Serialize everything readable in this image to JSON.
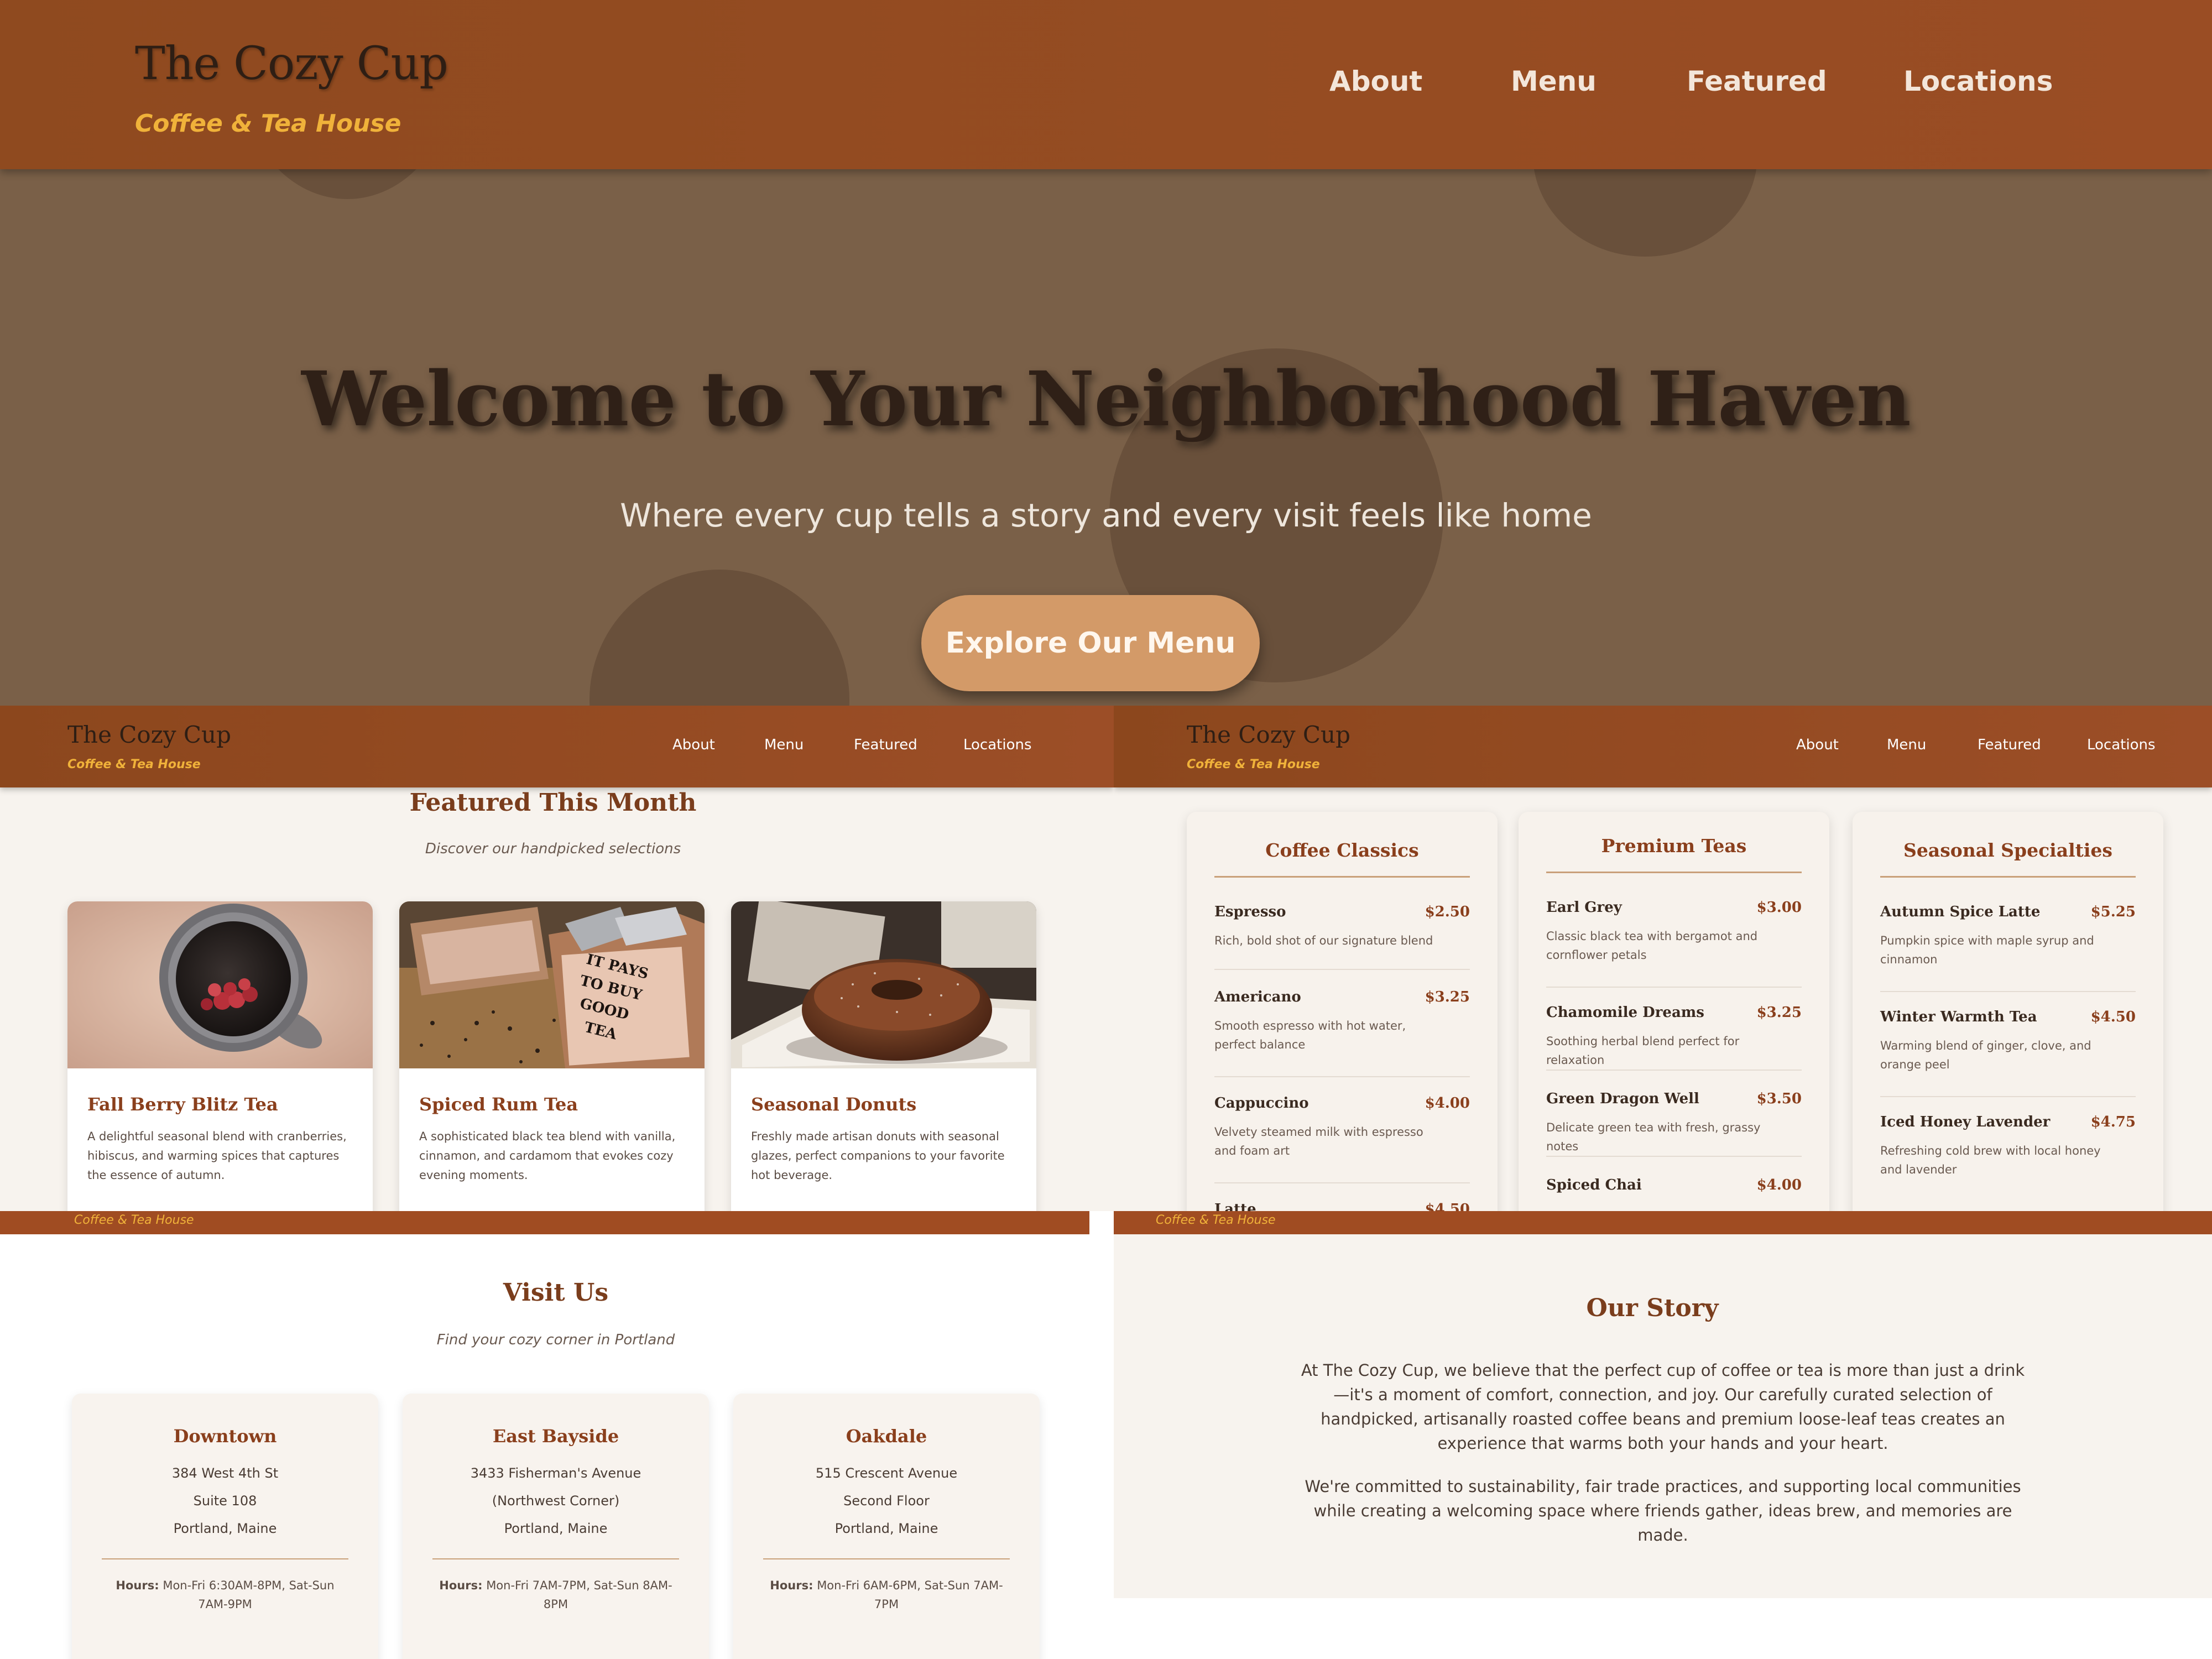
{
  "brand": {
    "name": "The Cozy Cup",
    "tagline": "Coffee & Tea House"
  },
  "nav": {
    "about": "About",
    "menu": "Menu",
    "featured": "Featured",
    "locations": "Locations"
  },
  "hero": {
    "title": "Welcome to Your Neighborhood Haven",
    "subtitle": "Where every cup tells a story and every visit feels like home",
    "cta": "Explore Our Menu"
  },
  "featured": {
    "title": "Featured This Month",
    "subtitle": "Discover our handpicked selections",
    "items": [
      {
        "name": "Fall Berry Blitz Tea",
        "desc": "A delightful seasonal blend with cranberries, hibiscus, and warming spices that captures the essence of autumn.",
        "image": "mug-of-berry-tea-photo"
      },
      {
        "name": "Spiced Rum Tea",
        "desc": "A sophisticated black tea blend with vanilla, cinnamon, and cardamom that evokes cozy evening moments.",
        "image": "loose-leaf-tea-box-photo",
        "box_text": "IT PAYS TO BUY GOOD TEA"
      },
      {
        "name": "Seasonal Donuts",
        "desc": "Freshly made artisan donuts with seasonal glazes, perfect companions to your favorite hot beverage.",
        "image": "donut-on-plate-photo"
      }
    ]
  },
  "menu": {
    "categories": [
      {
        "title": "Coffee Classics",
        "items": [
          {
            "name": "Espresso",
            "price": "$2.50",
            "desc": "Rich, bold shot of our signature blend"
          },
          {
            "name": "Americano",
            "price": "$3.25",
            "desc": "Smooth espresso with hot water, perfect balance"
          },
          {
            "name": "Cappuccino",
            "price": "$4.00",
            "desc": "Velvety steamed milk with espresso and foam art"
          },
          {
            "name": "Latte",
            "price": "$4.50",
            "desc": ""
          }
        ]
      },
      {
        "title": "Premium Teas",
        "items": [
          {
            "name": "Earl Grey",
            "price": "$3.00",
            "desc": "Classic black tea with bergamot and cornflower petals"
          },
          {
            "name": "Chamomile Dreams",
            "price": "$3.25",
            "desc": "Soothing herbal blend perfect for relaxation"
          },
          {
            "name": "Green Dragon Well",
            "price": "$3.50",
            "desc": "Delicate green tea with fresh, grassy notes"
          },
          {
            "name": "Spiced Chai",
            "price": "$4.00",
            "desc": ""
          }
        ]
      },
      {
        "title": "Seasonal Specialties",
        "items": [
          {
            "name": "Autumn Spice Latte",
            "price": "$5.25",
            "desc": "Pumpkin spice with maple syrup and cinnamon"
          },
          {
            "name": "Winter Warmth Tea",
            "price": "$4.50",
            "desc": "Warming blend of ginger, clove, and orange peel"
          },
          {
            "name": "Iced Honey Lavender",
            "price": "$4.75",
            "desc": "Refreshing cold brew with local honey and lavender"
          }
        ]
      }
    ]
  },
  "visit": {
    "title": "Visit Us",
    "subtitle": "Find your cozy corner in Portland",
    "hours_label": "Hours:",
    "locations": [
      {
        "name": "Downtown",
        "line1": "384 West 4th St",
        "line2": "Suite 108",
        "line3": "Portland, Maine",
        "hours": "Mon-Fri 6:30AM-8PM, Sat-Sun 7AM-9PM"
      },
      {
        "name": "East Bayside",
        "line1": "3433 Fisherman's Avenue",
        "line2": "(Northwest Corner)",
        "line3": "Portland, Maine",
        "hours": "Mon-Fri 7AM-7PM, Sat-Sun 8AM-8PM"
      },
      {
        "name": "Oakdale",
        "line1": "515 Crescent Avenue",
        "line2": "Second Floor",
        "line3": "Portland, Maine",
        "hours": "Mon-Fri 6AM-6PM, Sat-Sun 7AM-7PM"
      }
    ]
  },
  "story": {
    "title": "Our Story",
    "p1": "At The Cozy Cup, we believe that the perfect cup of coffee or tea is more than just a drink—it's a moment of comfort, connection, and joy. Our carefully curated selection of handpicked, artisanally roasted coffee beans and premium loose-leaf teas creates an experience that warms both your hands and your heart.",
    "p2": "We're committed to sustainability, fair trade practices, and supporting local communities while creating a welcoming space where friends gather, ideas brew, and memories are made."
  },
  "colors": {
    "header": "#9a4d24",
    "accent": "#8a3f1c",
    "tagline": "#f0b23a",
    "cta": "#d39a68",
    "hero_bg": "#7a6048",
    "section_bg": "#f7f3ee"
  }
}
